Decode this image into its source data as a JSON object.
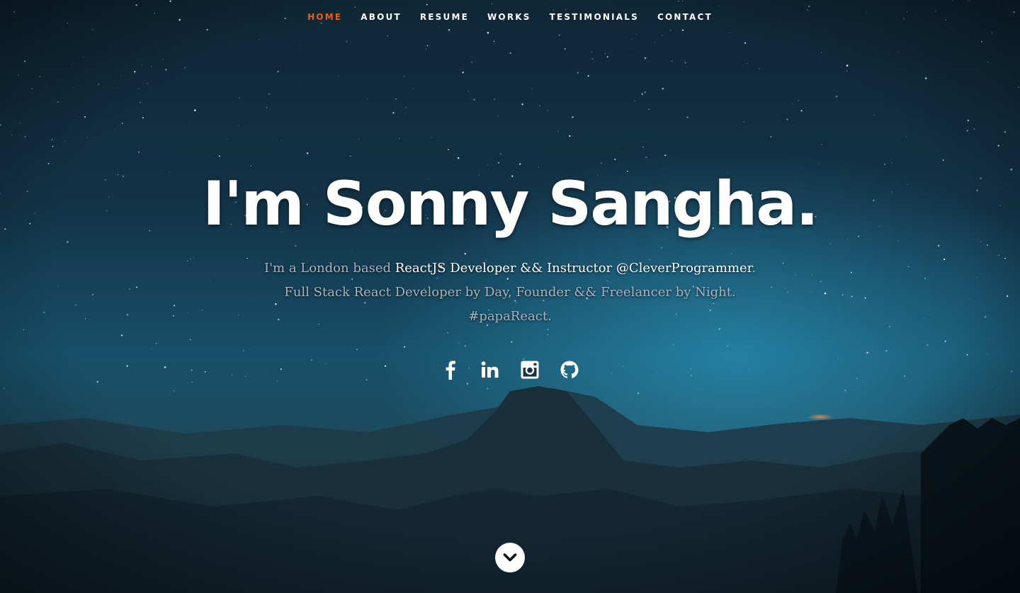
{
  "colors": {
    "accent": "#f06000",
    "nav_text": "#ffffff",
    "headline": "#ffffff",
    "subtext": "#a9b3bb",
    "highlight": "#ffffff"
  },
  "nav": {
    "items": [
      {
        "label": "Home",
        "current": true
      },
      {
        "label": "About",
        "current": false
      },
      {
        "label": "Resume",
        "current": false
      },
      {
        "label": "Works",
        "current": false
      },
      {
        "label": "Testimonials",
        "current": false
      },
      {
        "label": "Contact",
        "current": false
      }
    ]
  },
  "banner": {
    "headline": "I'm Sonny Sangha.",
    "intro_prefix": "I'm a London based ",
    "intro_highlight": "ReactJS Developer && Instructor @CleverProgrammer",
    "intro_suffix": ".",
    "line2": "Full Stack React Developer by Day, Founder && Freelancer by Night.",
    "line3": "#papaReact."
  },
  "social": [
    {
      "icon": "facebook-icon"
    },
    {
      "icon": "linkedin-icon"
    },
    {
      "icon": "instagram-icon"
    },
    {
      "icon": "github-icon"
    }
  ],
  "scroll_icon": "chevron-down-icon"
}
